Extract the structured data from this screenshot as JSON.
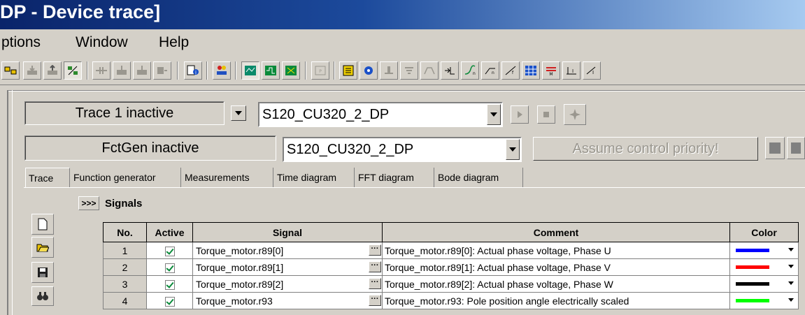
{
  "window": {
    "title": "DP - Device trace]"
  },
  "menu": [
    "ptions",
    "Window",
    "Help"
  ],
  "trace": {
    "status": "Trace 1 inactive",
    "device": "S120_CU320_2_DP"
  },
  "fctgen": {
    "status": "FctGen  inactive",
    "device": "S120_CU320_2_DP",
    "assume_label": "Assume control priority!"
  },
  "tabs": [
    "Trace",
    "Function generator",
    "Measurements",
    "Time diagram",
    "FFT diagram",
    "Bode diagram"
  ],
  "signals": {
    "expand_label": ">>>",
    "title": "Signals",
    "columns": [
      "No.",
      "Active",
      "Signal",
      "Comment",
      "Color"
    ],
    "rows": [
      {
        "no": "1",
        "signal": "Torque_motor.r89[0]",
        "comment": "Torque_motor.r89[0]: Actual phase voltage, Phase U",
        "color": "#0000ff"
      },
      {
        "no": "2",
        "signal": "Torque_motor.r89[1]",
        "comment": "Torque_motor.r89[1]: Actual phase voltage, Phase V",
        "color": "#ff0000"
      },
      {
        "no": "3",
        "signal": "Torque_motor.r89[2]",
        "comment": "Torque_motor.r89[2]: Actual phase voltage, Phase W",
        "color": "#000000"
      },
      {
        "no": "4",
        "signal": "Torque_motor.r93",
        "comment": "Torque_motor.r93: Pole position angle electrically scaled",
        "color": "#00ff00"
      }
    ]
  },
  "icons": {
    "side": [
      "new-file-icon",
      "open-folder-icon",
      "save-disk-icon",
      "binoculars-icon"
    ]
  }
}
